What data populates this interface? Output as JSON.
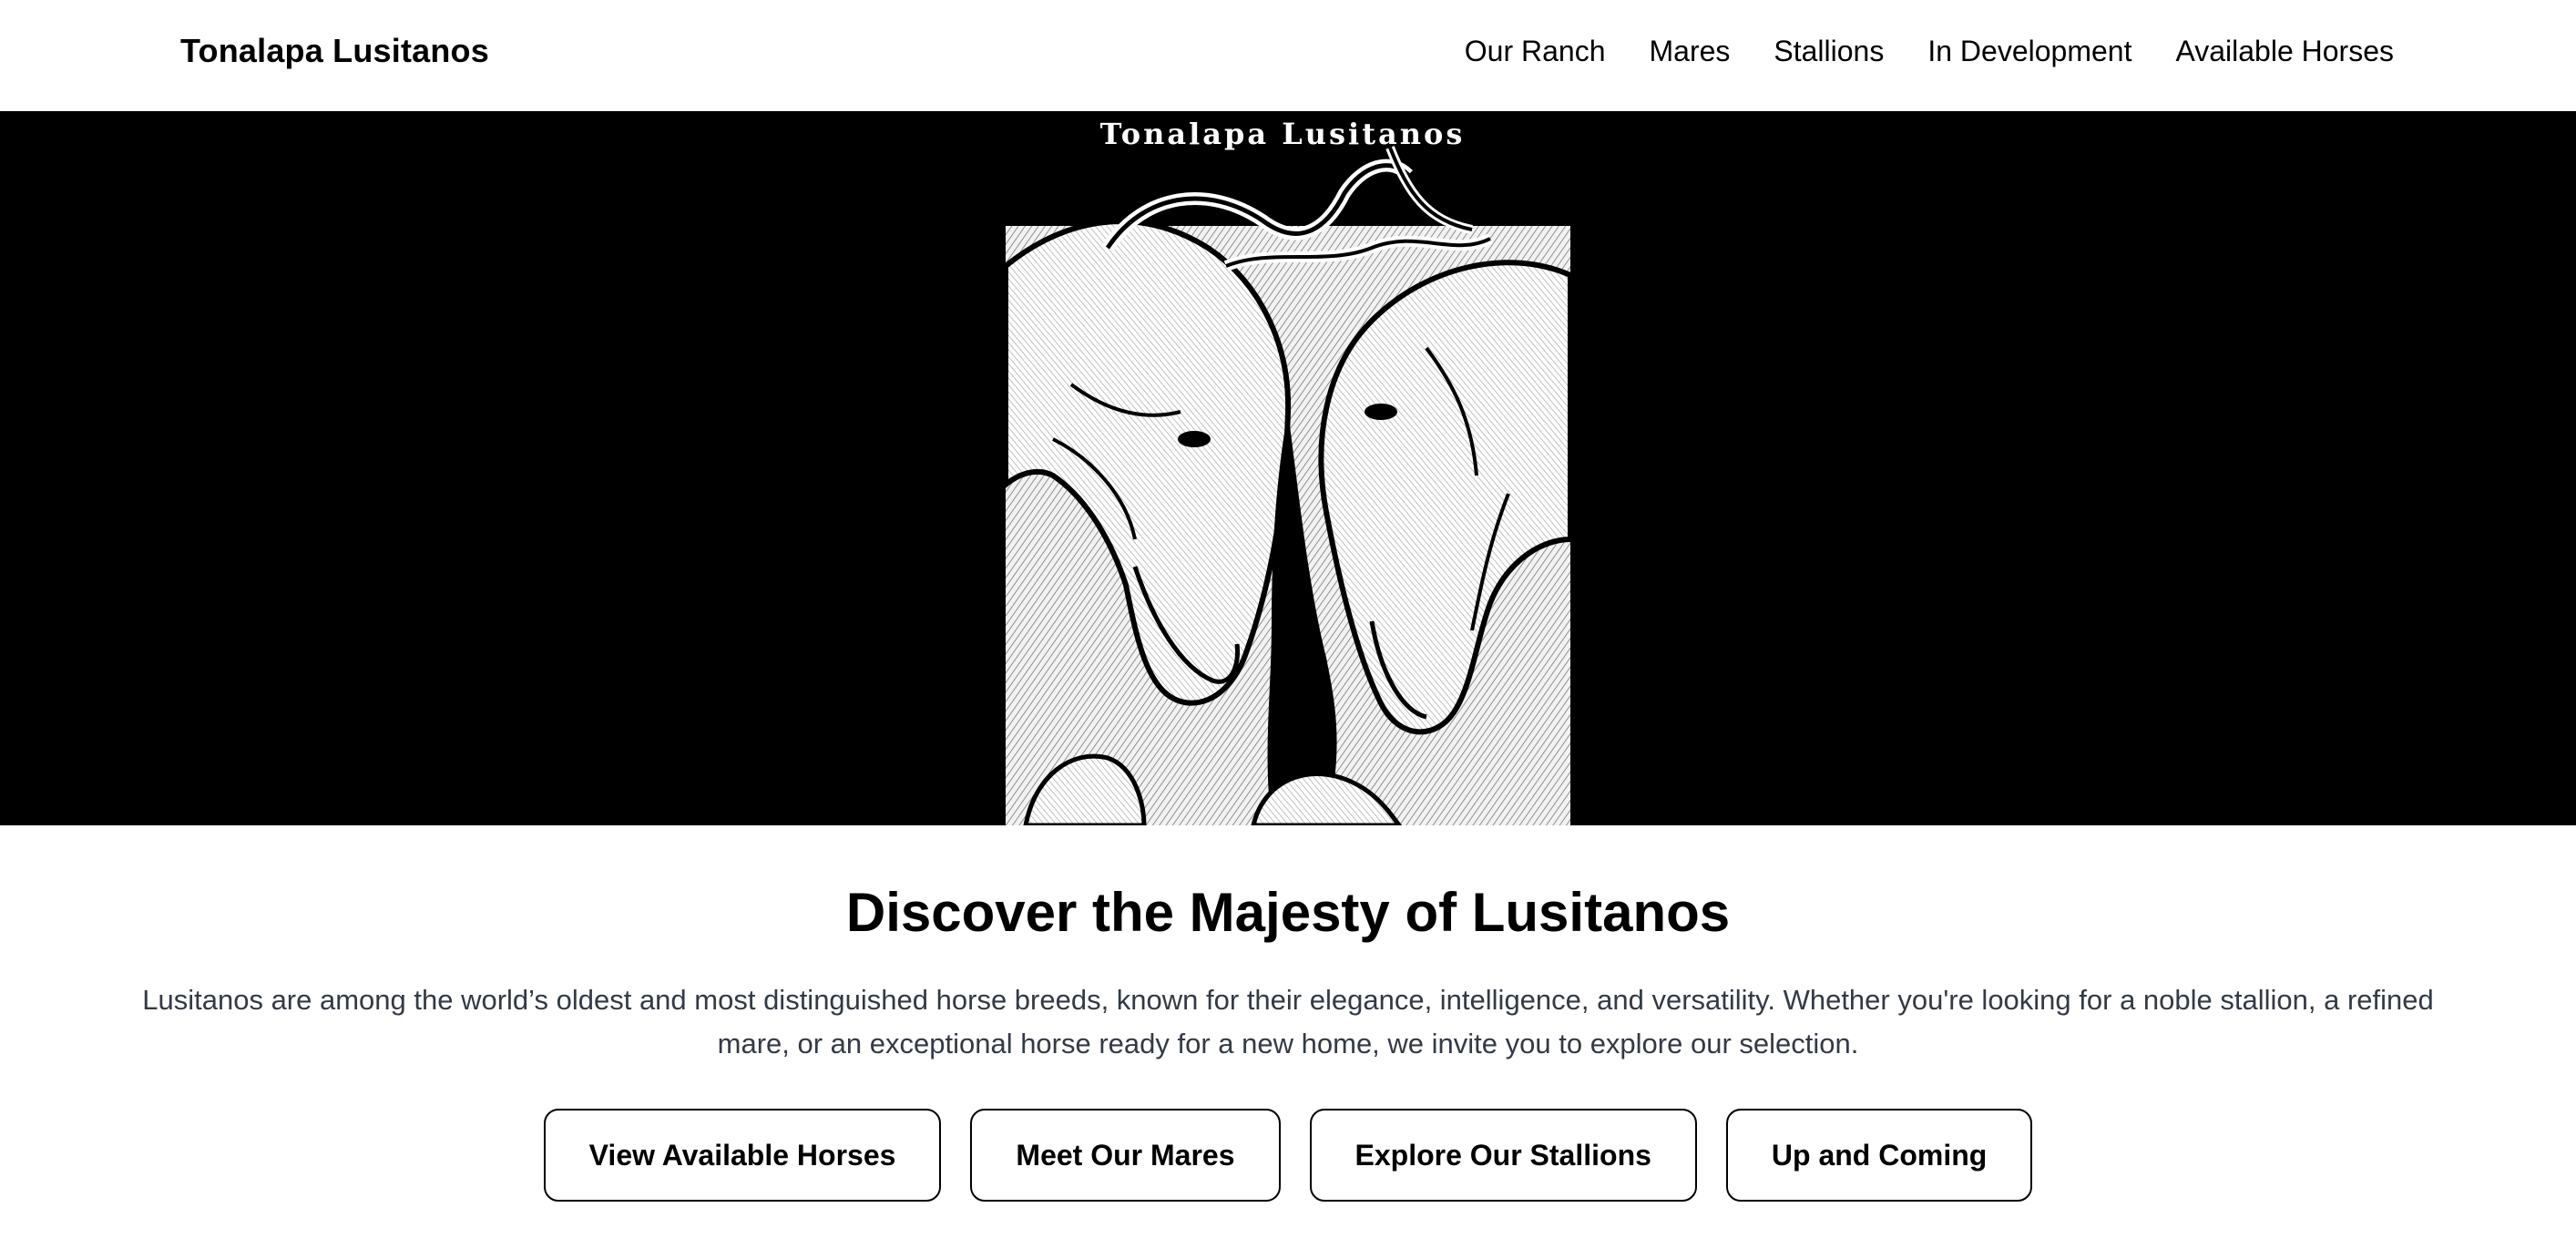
{
  "header": {
    "brand": "Tonalapa Lusitanos",
    "nav": [
      {
        "label": "Our Ranch"
      },
      {
        "label": "Mares"
      },
      {
        "label": "Stallions"
      },
      {
        "label": "In Development"
      },
      {
        "label": "Available Horses"
      }
    ]
  },
  "hero": {
    "banner_text": "Tonalapa Lusitanos",
    "background_color": "#000000",
    "image_subject": "two-horses-illustration"
  },
  "intro": {
    "title": "Discover the Majesty of Lusitanos",
    "text": "Lusitanos are among the world’s oldest and most distinguished horse breeds, known for their elegance, intelligence, and versatility. Whether you're looking for a noble stallion, a refined mare, or an exceptional horse ready for a new home, we invite you to explore our selection.",
    "buttons": [
      {
        "label": "View Available Horses"
      },
      {
        "label": "Meet Our Mares"
      },
      {
        "label": "Explore Our Stallions"
      },
      {
        "label": "Up and Coming"
      }
    ]
  },
  "colors": {
    "text": "#000000",
    "body_text": "#333a46",
    "background": "#ffffff",
    "hero_background": "#000000"
  }
}
